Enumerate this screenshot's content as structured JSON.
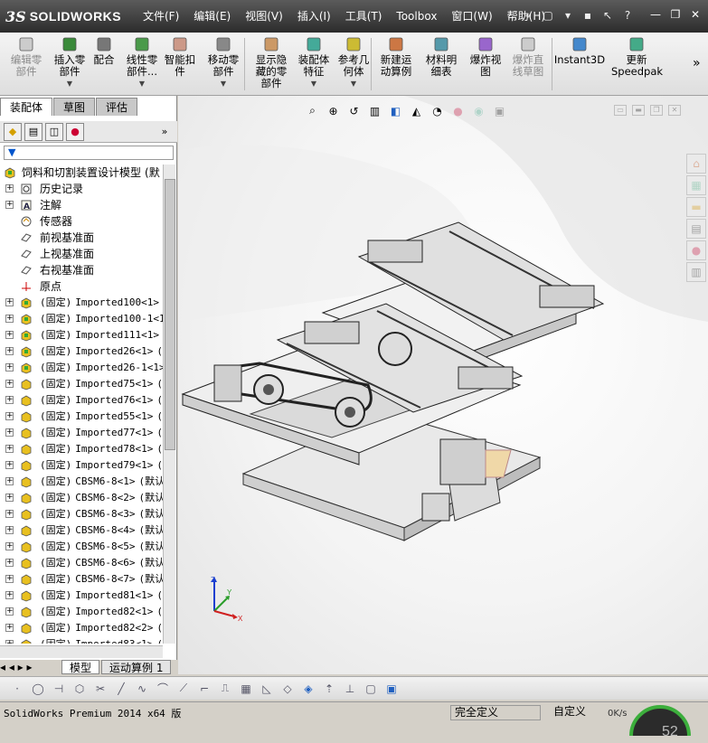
{
  "app": {
    "brand": "SOLIDWORKS",
    "brand_prefix": "3S"
  },
  "menu": [
    "文件(F)",
    "编辑(E)",
    "视图(V)",
    "插入(I)",
    "工具(T)",
    "Toolbox",
    "窗口(W)",
    "帮助(H)"
  ],
  "ribbon": [
    {
      "label": "编辑零\n部件",
      "icon": "edit-component-icon",
      "disabled": true
    },
    {
      "label": "插入零\n部件",
      "icon": "insert-component-icon",
      "disabled": false,
      "dropdown": true
    },
    {
      "label": "配合",
      "icon": "mate-icon",
      "disabled": false
    },
    {
      "label": "线性零\n部件...",
      "icon": "linear-pattern-icon",
      "disabled": false,
      "dropdown": true
    },
    {
      "label": "智能扣\n件",
      "icon": "smart-fasteners-icon",
      "disabled": false
    },
    {
      "label": "移动零\n部件",
      "icon": "move-component-icon",
      "disabled": false,
      "dropdown": true
    },
    {
      "label": "显示隐\n藏的零\n部件",
      "icon": "show-hidden-icon",
      "disabled": false
    },
    {
      "label": "装配体\n特征",
      "icon": "assembly-features-icon",
      "disabled": false,
      "dropdown": true
    },
    {
      "label": "参考几\n何体",
      "icon": "reference-geometry-icon",
      "disabled": false,
      "dropdown": true
    },
    {
      "label": "新建运\n动算例",
      "icon": "new-motion-study-icon",
      "disabled": false
    },
    {
      "label": "材料明\n细表",
      "icon": "bom-icon",
      "disabled": false
    },
    {
      "label": "爆炸视\n图",
      "icon": "exploded-view-icon",
      "disabled": false
    },
    {
      "label": "爆炸直\n线草图",
      "icon": "explode-line-sketch-icon",
      "disabled": true
    },
    {
      "label": "Instant3D",
      "icon": "instant3d-icon",
      "disabled": false
    },
    {
      "label": "更新\nSpeedpak",
      "icon": "speedpak-icon",
      "disabled": false
    }
  ],
  "panel_tabs": [
    "装配体",
    "草图",
    "评估"
  ],
  "tree_root": "饲料和切割装置设计模型",
  "tree_root_suffix": "(默",
  "tree_fixed_items": [
    "历史记录",
    "注解",
    "传感器",
    "前视基准面",
    "上视基准面",
    "右视基准面",
    "原点"
  ],
  "tree_components": [
    {
      "prefix": "(固定)",
      "name": "Imported100<1>",
      "suffix": "("
    },
    {
      "prefix": "(固定)",
      "name": "Imported100-1<1>",
      "suffix": ""
    },
    {
      "prefix": "(固定)",
      "name": "Imported111<1>",
      "suffix": "("
    },
    {
      "prefix": "(固定)",
      "name": "Imported26<1>",
      "suffix": "(默"
    },
    {
      "prefix": "(固定)",
      "name": "Imported26-1<1>",
      "suffix": ""
    },
    {
      "prefix": "(固定)",
      "name": "Imported75<1>",
      "suffix": "(默"
    },
    {
      "prefix": "(固定)",
      "name": "Imported76<1>",
      "suffix": "(默"
    },
    {
      "prefix": "(固定)",
      "name": "Imported55<1>",
      "suffix": "(默"
    },
    {
      "prefix": "(固定)",
      "name": "Imported77<1>",
      "suffix": "(默"
    },
    {
      "prefix": "(固定)",
      "name": "Imported78<1>",
      "suffix": "(默"
    },
    {
      "prefix": "(固定)",
      "name": "Imported79<1>",
      "suffix": "(默"
    },
    {
      "prefix": "(固定)",
      "name": "CBSM6-8<1>",
      "suffix": "(默认"
    },
    {
      "prefix": "(固定)",
      "name": "CBSM6-8<2>",
      "suffix": "(默认"
    },
    {
      "prefix": "(固定)",
      "name": "CBSM6-8<3>",
      "suffix": "(默认"
    },
    {
      "prefix": "(固定)",
      "name": "CBSM6-8<4>",
      "suffix": "(默认"
    },
    {
      "prefix": "(固定)",
      "name": "CBSM6-8<5>",
      "suffix": "(默认"
    },
    {
      "prefix": "(固定)",
      "name": "CBSM6-8<6>",
      "suffix": "(默认"
    },
    {
      "prefix": "(固定)",
      "name": "CBSM6-8<7>",
      "suffix": "(默认"
    },
    {
      "prefix": "(固定)",
      "name": "Imported81<1>",
      "suffix": "(默"
    },
    {
      "prefix": "(固定)",
      "name": "Imported82<1>",
      "suffix": "(默"
    },
    {
      "prefix": "(固定)",
      "name": "Imported82<2>",
      "suffix": "(默"
    },
    {
      "prefix": "(固定)",
      "name": "Imported83<1>",
      "suffix": "("
    }
  ],
  "bottom_tabs": [
    "模型",
    "运动算例 1"
  ],
  "status": {
    "app_version": "SolidWorks Premium 2014 x64 版",
    "definition": "完全定义",
    "custom": "自定义",
    "net_rate": "0K/s",
    "gauge_value": "52"
  },
  "colors": {
    "accent": "#2a7d2a",
    "titlebar": "#3a3a3a"
  }
}
